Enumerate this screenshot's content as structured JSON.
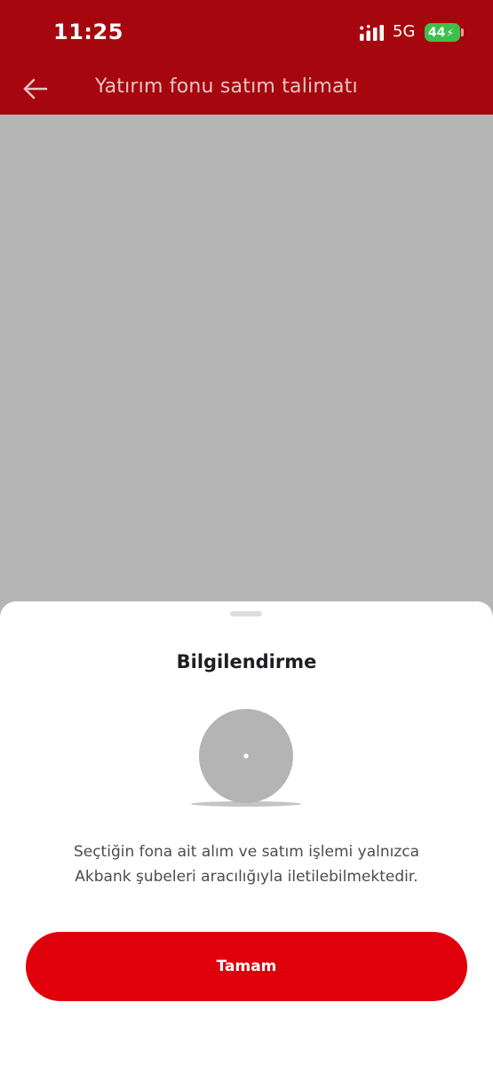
{
  "status_bar": {
    "time": "11:25",
    "network": "5G",
    "battery_level": "44",
    "battery_color": "#3fbf4a"
  },
  "header": {
    "title": "Yatırım fonu satım talimatı",
    "back_icon": "arrow-left-icon",
    "background_color": "#a6070e"
  },
  "sheet": {
    "title": "Bilgilendirme",
    "illustration": "info-illustration",
    "message_line_1": "Seçtiğin fona ait alım ve satım işlemi yalnızca",
    "message_line_2": "Akbank şubeleri aracılığıyla iletilebilmektedir.",
    "primary_button_label": "Tamam",
    "primary_button_color": "#e0000b"
  }
}
